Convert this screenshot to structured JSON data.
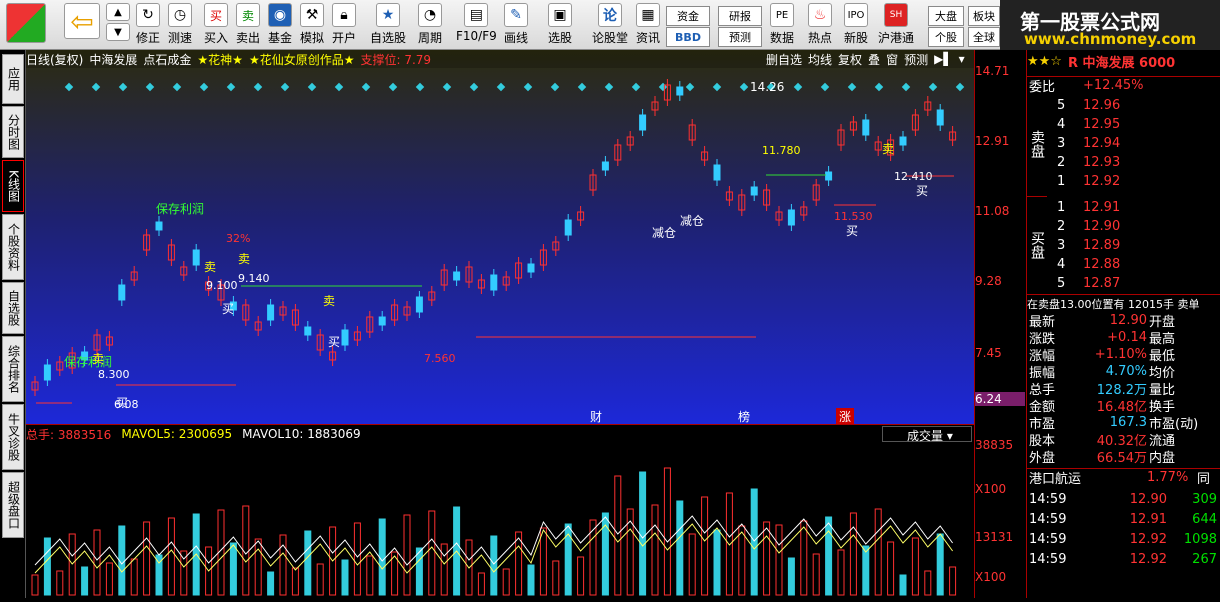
{
  "toolbar": {
    "buttons": [
      "修正",
      "测速",
      "买入",
      "卖出",
      "基金",
      "模拟",
      "开户",
      "自选股",
      "周期",
      "F10/F9",
      "画线",
      "选股",
      "论股堂",
      "资讯",
      "数据",
      "热点",
      "新股",
      "沪港通",
      "个股",
      "全球"
    ],
    "mini": [
      "资金",
      "BBD",
      "研报",
      "预测",
      "大盘",
      "板块"
    ]
  },
  "brand": {
    "title": "第一股票公式网",
    "url": "www.chnmoney.com"
  },
  "nav": [
    "应用",
    "分时图",
    "K线图",
    "个股资料",
    "自选股",
    "综合排名",
    "牛叉诊股",
    "超级盘口"
  ],
  "chart": {
    "header": [
      "日线(复权)",
      "中海发展",
      "点石成金",
      "★花神★",
      "★花仙女原创作品★",
      "支撑位: 7.79"
    ],
    "tools": [
      "删自选",
      "均线",
      "复权",
      "叠",
      "窗",
      "预测"
    ],
    "annotations": {
      "save1": "保存利润",
      "save2": "保存利润",
      "reduce1": "减仓",
      "reduce2": "减仓",
      "sell": "卖",
      "buy": "买",
      "high": "14.26",
      "pct": "32%",
      "l1": "9.140",
      "l2": "9.100",
      "l3": "11.780",
      "l4": "11.530",
      "l5": "7.560",
      "l6": "8.300",
      "l7": "6.08",
      "l8": "12.410",
      "b1": "财",
      "b2": "榜",
      "b3": "涨"
    }
  },
  "yaxis": [
    "14.71",
    "12.91",
    "11.08",
    "9.28",
    "7.45",
    "6.24"
  ],
  "volume": {
    "label_total": "总手: 3883516",
    "label_ma5": "MAVOL5: 2300695",
    "label_ma10": "MAVOL10: 1883069",
    "selector": "成交量",
    "y1": "38835",
    "y2": "X100",
    "y3": "13131",
    "y4": "X100"
  },
  "panel": {
    "title": "R 中海发展 6000",
    "weibi_label": "委比",
    "weibi_val": "+12.45%",
    "sell_label": "卖盘",
    "buy_label": "买盘",
    "sell": [
      {
        "n": "5",
        "p": "12.96"
      },
      {
        "n": "4",
        "p": "12.95"
      },
      {
        "n": "3",
        "p": "12.94"
      },
      {
        "n": "2",
        "p": "12.93"
      },
      {
        "n": "1",
        "p": "12.92"
      }
    ],
    "buy": [
      {
        "n": "1",
        "p": "12.91"
      },
      {
        "n": "2",
        "p": "12.90"
      },
      {
        "n": "3",
        "p": "12.89"
      },
      {
        "n": "4",
        "p": "12.88"
      },
      {
        "n": "5",
        "p": "12.87"
      }
    ],
    "note": "在卖盘13.00位置有 12015手 卖单",
    "quote": [
      {
        "a": "最新",
        "b": "12.90",
        "c": "开盘"
      },
      {
        "a": "涨跌",
        "b": "+0.14",
        "c": "最高"
      },
      {
        "a": "涨幅",
        "b": "+1.10%",
        "c": "最低"
      },
      {
        "a": "振幅",
        "b": "4.70%",
        "c": "均价"
      },
      {
        "a": "总手",
        "b": "128.2万",
        "c": "量比"
      },
      {
        "a": "金额",
        "b": "16.48亿",
        "c": "换手"
      },
      {
        "a": "市盈",
        "b": "167.3",
        "c": "市盈(动)"
      },
      {
        "a": "股本",
        "b": "40.32亿",
        "c": "流通"
      },
      {
        "a": "外盘",
        "b": "66.54万",
        "c": "内盘"
      }
    ],
    "sector": {
      "name": "港口航运",
      "pct": "1.77%",
      "tag": "同"
    },
    "ticks": [
      {
        "t": "14:59",
        "p": "12.90",
        "v": "309"
      },
      {
        "t": "14:59",
        "p": "12.91",
        "v": "644"
      },
      {
        "t": "14:59",
        "p": "12.92",
        "v": "1098"
      },
      {
        "t": "14:59",
        "p": "12.92",
        "v": "267"
      }
    ]
  }
}
